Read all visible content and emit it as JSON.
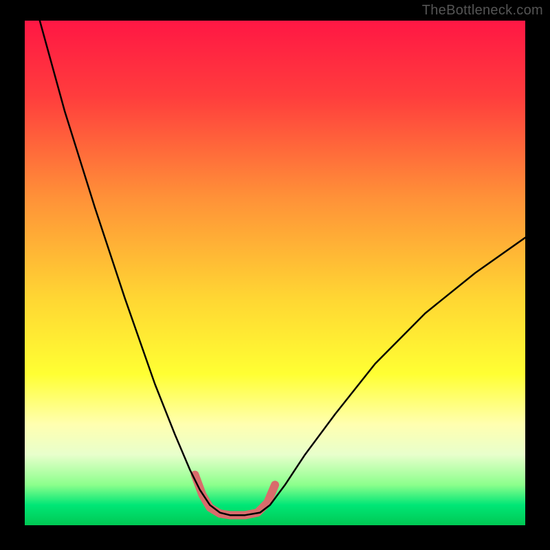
{
  "watermark": "TheBottleneck.com",
  "chart_data": {
    "type": "line",
    "title": "",
    "xlabel": "",
    "ylabel": "",
    "xlim": [
      0,
      100
    ],
    "ylim": [
      0,
      100
    ],
    "gradient_stops": [
      {
        "offset": 0,
        "color": "#ff1744"
      },
      {
        "offset": 15,
        "color": "#ff3d3d"
      },
      {
        "offset": 35,
        "color": "#ff9138"
      },
      {
        "offset": 55,
        "color": "#ffd633"
      },
      {
        "offset": 70,
        "color": "#ffff33"
      },
      {
        "offset": 80,
        "color": "#ffffb0"
      },
      {
        "offset": 86,
        "color": "#e8ffcc"
      },
      {
        "offset": 92,
        "color": "#8cff8c"
      },
      {
        "offset": 96,
        "color": "#00e676"
      },
      {
        "offset": 100,
        "color": "#00c853"
      }
    ],
    "series": [
      {
        "name": "bottleneck-curve",
        "color": "#000000",
        "stroke_width": 2.5,
        "points": [
          {
            "x": 3,
            "y": 100
          },
          {
            "x": 8,
            "y": 82
          },
          {
            "x": 14,
            "y": 63
          },
          {
            "x": 20,
            "y": 45
          },
          {
            "x": 26,
            "y": 28
          },
          {
            "x": 30,
            "y": 18
          },
          {
            "x": 33,
            "y": 11
          },
          {
            "x": 35,
            "y": 7
          },
          {
            "x": 37,
            "y": 4
          },
          {
            "x": 39,
            "y": 2.5
          },
          {
            "x": 41,
            "y": 2
          },
          {
            "x": 44,
            "y": 2
          },
          {
            "x": 47,
            "y": 2.5
          },
          {
            "x": 49,
            "y": 4
          },
          {
            "x": 52,
            "y": 8
          },
          {
            "x": 56,
            "y": 14
          },
          {
            "x": 62,
            "y": 22
          },
          {
            "x": 70,
            "y": 32
          },
          {
            "x": 80,
            "y": 42
          },
          {
            "x": 90,
            "y": 50
          },
          {
            "x": 100,
            "y": 57
          }
        ]
      },
      {
        "name": "highlight-segment",
        "color": "#d96c6c",
        "stroke_width": 12,
        "points": [
          {
            "x": 34,
            "y": 10
          },
          {
            "x": 35.5,
            "y": 6
          },
          {
            "x": 37,
            "y": 3.5
          },
          {
            "x": 39,
            "y": 2.3
          },
          {
            "x": 41,
            "y": 2
          },
          {
            "x": 44,
            "y": 2
          },
          {
            "x": 46.5,
            "y": 2.5
          },
          {
            "x": 48.5,
            "y": 4.5
          },
          {
            "x": 50,
            "y": 8
          }
        ]
      }
    ]
  }
}
